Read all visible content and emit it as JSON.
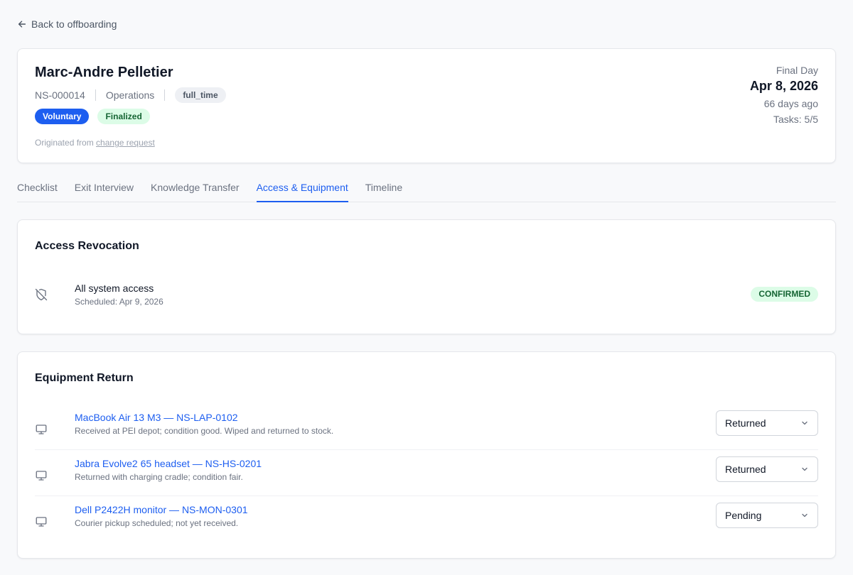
{
  "nav": {
    "back_label": "Back to offboarding"
  },
  "employee": {
    "name": "Marc-Andre Pelletier",
    "id": "NS-000014",
    "department": "Operations",
    "employment_type": "full_time",
    "badges": [
      "Voluntary",
      "Finalized"
    ],
    "origin_prefix": "Originated from",
    "origin_link": "change request"
  },
  "summary": {
    "final_day_label": "Final Day",
    "final_day": "Apr 8, 2026",
    "days_ago": "66 days ago",
    "tasks": "Tasks: 5/5"
  },
  "tabs": [
    "Checklist",
    "Exit Interview",
    "Knowledge Transfer",
    "Access & Equipment",
    "Timeline"
  ],
  "active_tab": "Access & Equipment",
  "access": {
    "title": "Access Revocation",
    "items": [
      {
        "icon": "shield-off-icon",
        "title": "All system access",
        "subtitle": "Scheduled: Apr 9, 2026",
        "status": "CONFIRMED"
      }
    ]
  },
  "equipment": {
    "title": "Equipment Return",
    "items": [
      {
        "icon": "monitor-icon",
        "title": "MacBook Air 13 M3 — NS-LAP-0102",
        "note": "Received at PEI depot; condition good. Wiped and returned to stock.",
        "status": "Returned"
      },
      {
        "icon": "monitor-icon",
        "title": "Jabra Evolve2 65 headset — NS-HS-0201",
        "note": "Returned with charging cradle; condition fair.",
        "status": "Returned"
      },
      {
        "icon": "monitor-icon",
        "title": "Dell P2422H monitor — NS-MON-0301",
        "note": "Courier pickup scheduled; not yet received.",
        "status": "Pending"
      }
    ]
  },
  "colors": {
    "accent": "#1d5ef0",
    "success_bg": "#dcfce7",
    "success_text": "#166534"
  }
}
